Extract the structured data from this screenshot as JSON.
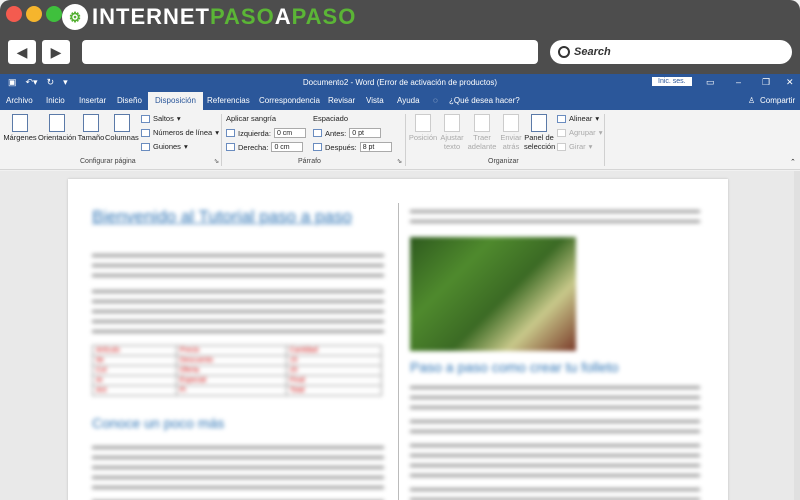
{
  "browser": {
    "logo_part1": "INTERNET",
    "logo_part2": "PASO",
    "logo_part3": "A",
    "logo_part4": "PASO",
    "back_icon": "◀",
    "forward_icon": "▶",
    "search_label": "Search"
  },
  "word": {
    "title": "Documento2 - Word (Error de activación de productos)",
    "sign_in": "Inic. ses.",
    "tabs": [
      "Archivo",
      "Inicio",
      "Insertar",
      "Diseño",
      "Disposición",
      "Referencias",
      "Correspondencia",
      "Revisar",
      "Vista",
      "Ayuda",
      "¿Qué desea hacer?"
    ],
    "share": "Compartir",
    "ribbon": {
      "margins": "Márgenes",
      "orientation": "Orientación",
      "size": "Tamaño",
      "columns": "Columnas",
      "breaks": "Saltos",
      "line_numbers": "Números de línea",
      "hyphenation": "Guiones",
      "group_page_setup": "Configurar página",
      "indent_label": "Aplicar sangría",
      "indent_left_label": "Izquierda:",
      "indent_left_value": "0 cm",
      "indent_right_label": "Derecha:",
      "indent_right_value": "0 cm",
      "spacing_label": "Espaciado",
      "spacing_before_label": "Antes:",
      "spacing_before_value": "0 pt",
      "spacing_after_label": "Después:",
      "spacing_after_value": "8 pt",
      "group_paragraph": "Párrafo",
      "position": "Posición",
      "wrap1": "Ajustar",
      "wrap2": "texto",
      "forward1": "Traer",
      "forward2": "adelante",
      "backward1": "Enviar",
      "backward2": "atrás",
      "selection_pane1": "Panel de",
      "selection_pane2": "selección",
      "align": "Alinear",
      "group": "Agrupar",
      "rotate": "Girar",
      "group_arrange": "Organizar"
    }
  },
  "document": {
    "heading1": "Bienvenido al Tutorial paso a paso",
    "heading2": "Conoce un poco más",
    "heading3": "Paso a paso como crear tu folleto",
    "table_rows": [
      [
        "Artículo",
        "Precio",
        "Cantidad"
      ],
      [
        "Ite",
        "Descuento",
        "15"
      ],
      [
        "Col",
        "Oferta",
        "20"
      ],
      [
        "Ar",
        "Especial",
        "Final"
      ],
      [
        "Ant",
        "Pi",
        "Total"
      ]
    ]
  }
}
